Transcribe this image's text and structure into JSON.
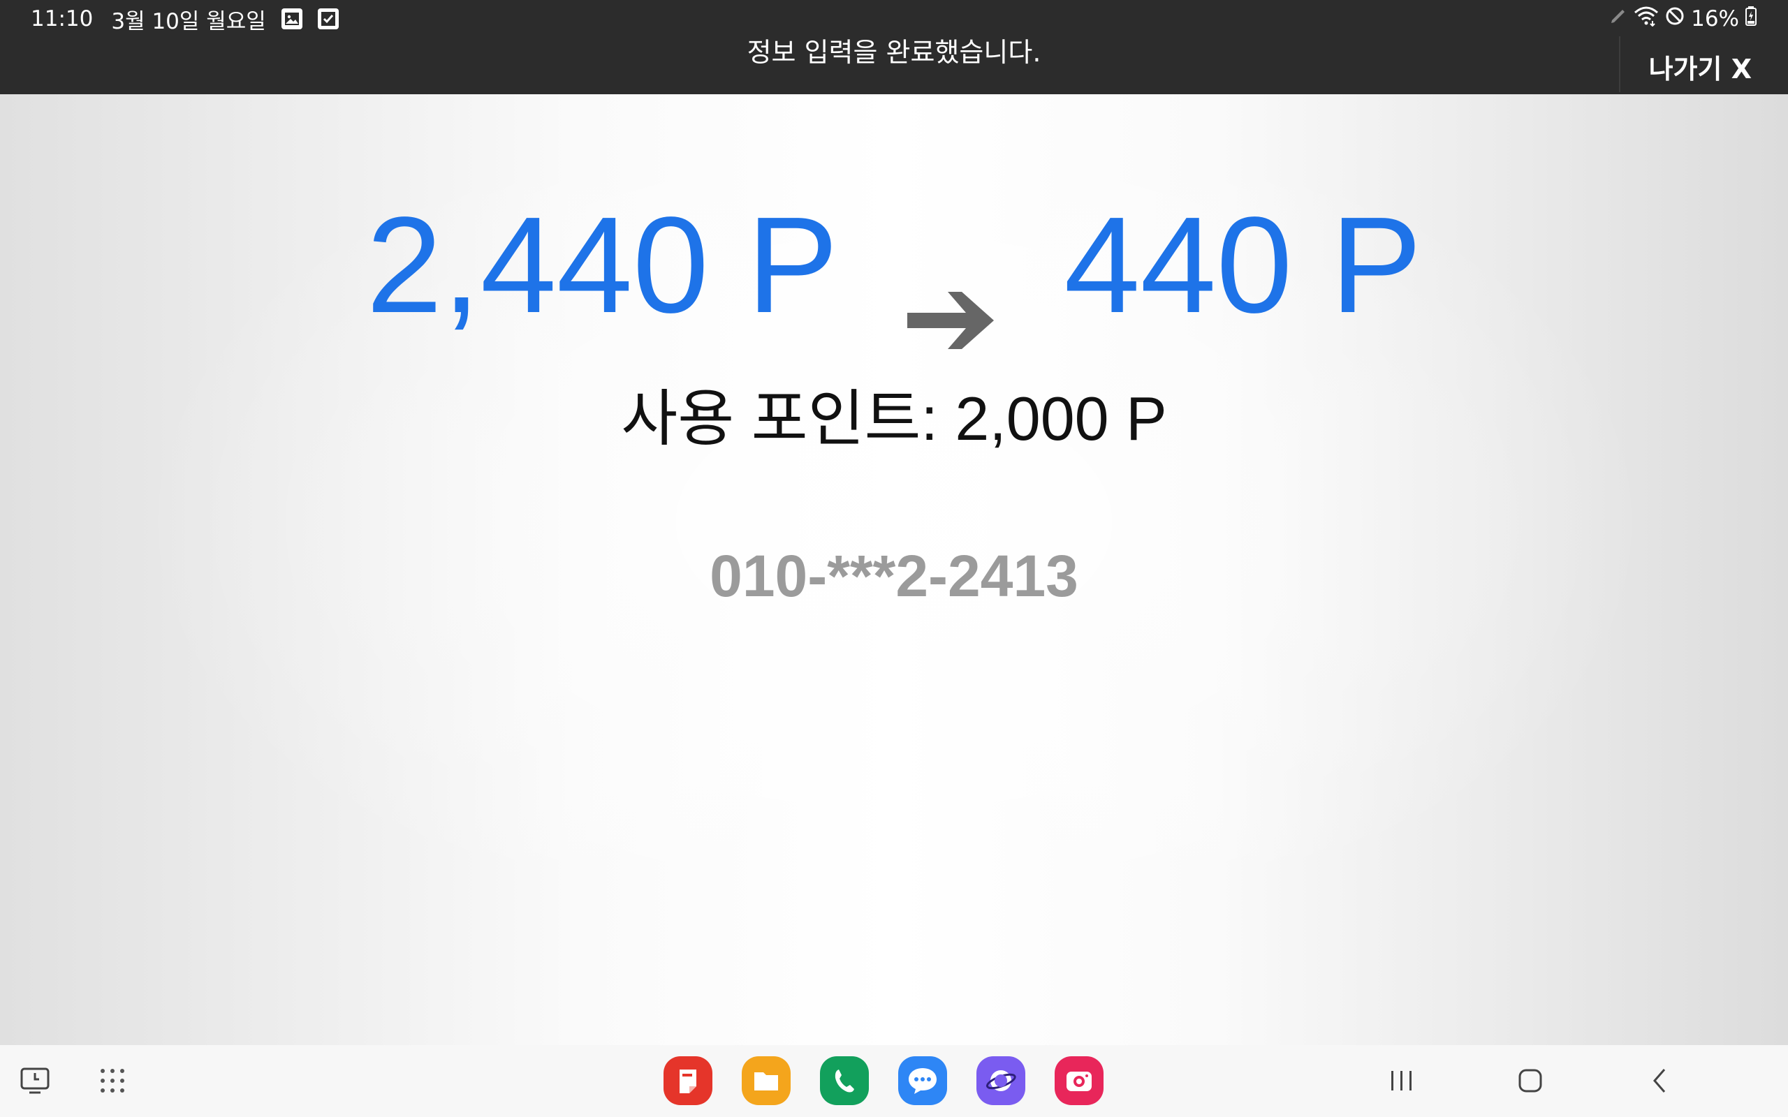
{
  "status_bar": {
    "time": "11:10",
    "date": "3월 10일 월요일",
    "battery": "16%"
  },
  "topbar": {
    "message": "정보 입력을 완료했습니다.",
    "exit_label": "나가기 X"
  },
  "points": {
    "before": "2,440 P",
    "after": "440 P",
    "used": "사용 포인트: 2,000 P",
    "phone": "010-***2-2413"
  },
  "colors": {
    "topbar_bg": "#2c2c2c",
    "points_blue": "#1e73e8",
    "arrow_gray": "#666666",
    "phone_gray": "#9b9b9b"
  },
  "dock_apps": [
    {
      "name": "samsung-notes-icon",
      "color": "#e5352a"
    },
    {
      "name": "my-files-icon",
      "color": "#f4a51c"
    },
    {
      "name": "phone-app-icon",
      "color": "#12a05c"
    },
    {
      "name": "messages-app-icon",
      "color": "#2e86f5"
    },
    {
      "name": "samsung-internet-icon",
      "color": "#7a5cf0"
    },
    {
      "name": "camera-app-icon",
      "color": "#e8265a"
    }
  ]
}
